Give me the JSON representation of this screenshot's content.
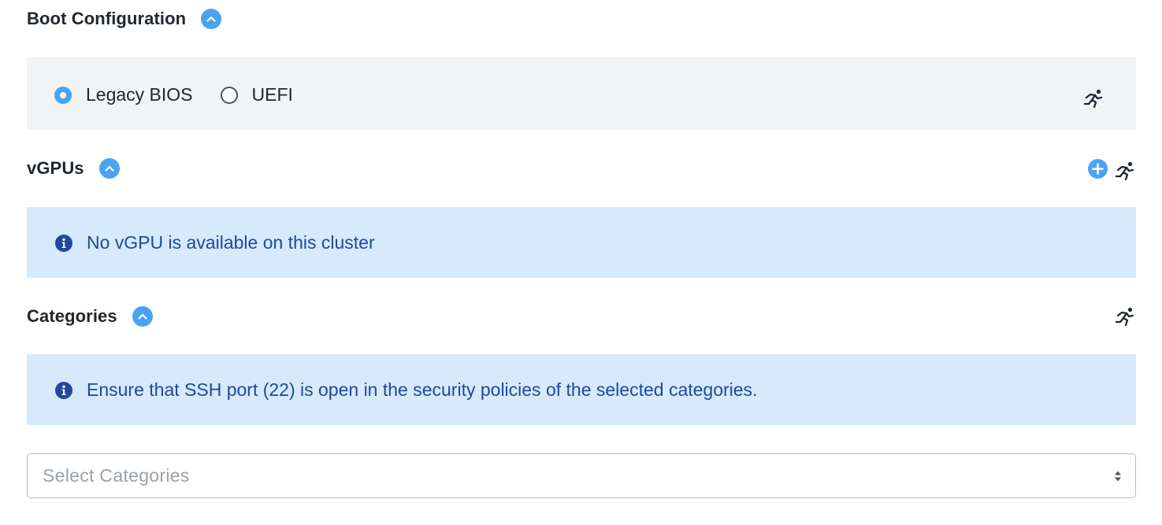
{
  "boot": {
    "title": "Boot Configuration",
    "options": [
      "Legacy BIOS",
      "UEFI"
    ],
    "selected": "Legacy BIOS"
  },
  "vgpus": {
    "title": "vGPUs",
    "info_message": "No vGPU is available on this cluster"
  },
  "categories": {
    "title": "Categories",
    "info_message": "Ensure that SSH port (22) is open in the security policies of the selected categories.",
    "select_placeholder": "Select Categories"
  },
  "icons": {
    "collapse": "chevron-up-icon",
    "runtime": "running-person-icon",
    "add": "plus-circle-icon",
    "info": "info-icon",
    "select": "sort-arrows-icon"
  },
  "colors": {
    "accent": "#4aa3f0",
    "info_background": "#d6eafb",
    "info_text": "#22479e",
    "panel_background": "#f2f3f5"
  }
}
